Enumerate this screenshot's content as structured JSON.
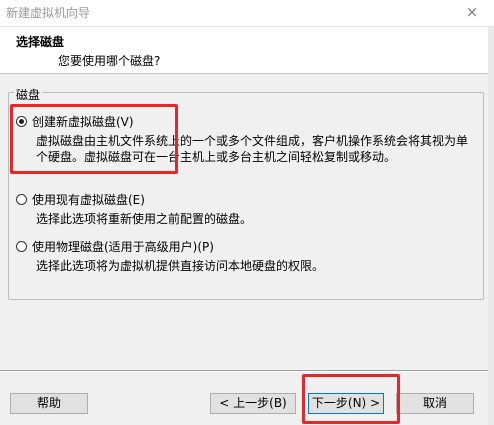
{
  "window": {
    "title": "新建虚拟机向导",
    "close_icon": "×"
  },
  "header": {
    "title": "选择磁盘",
    "subtitle": "您要使用哪个磁盘?"
  },
  "group": {
    "label": "磁盘"
  },
  "options": [
    {
      "label": "创建新虚拟磁盘(V)",
      "selected": true,
      "description": "虚拟磁盘由主机文件系统上的一个或多个文件组成，客户机操作系统会将其视为单个硬盘。虚拟磁盘可在一台主机上或多台主机之间轻松复制或移动。"
    },
    {
      "label": "使用现有虚拟磁盘(E)",
      "selected": false,
      "description": "选择此选项将重新使用之前配置的磁盘。"
    },
    {
      "label": "使用物理磁盘(适用于高级用户)(P)",
      "selected": false,
      "description": "选择此选项将为虚拟机提供直接访问本地硬盘的权限。"
    }
  ],
  "buttons": {
    "help": "帮助",
    "back": "< 上一步(B)",
    "next": "下一步(N) >",
    "cancel": "取消"
  },
  "colors": {
    "highlight": "#e8262a",
    "dialog_bg": "#f0f0f0"
  }
}
